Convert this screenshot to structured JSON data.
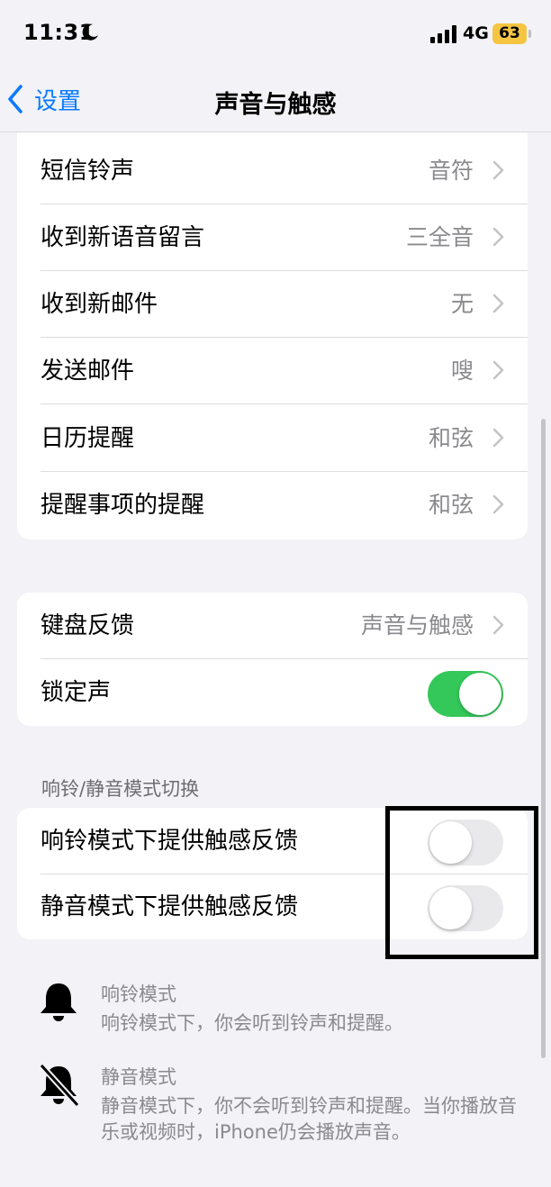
{
  "status": {
    "time": "11:31",
    "network": "4G",
    "battery": "63"
  },
  "nav": {
    "back_label": "设置",
    "title": "声音与触感"
  },
  "alerts": [
    {
      "label": "短信铃声",
      "value": "音符"
    },
    {
      "label": "收到新语音留言",
      "value": "三全音"
    },
    {
      "label": "收到新邮件",
      "value": "无"
    },
    {
      "label": "发送邮件",
      "value": "嗖"
    },
    {
      "label": "日历提醒",
      "value": "和弦"
    },
    {
      "label": "提醒事项的提醒",
      "value": "和弦"
    }
  ],
  "feedback": {
    "keyboard_label": "键盘反馈",
    "keyboard_value": "声音与触感",
    "lock_sound_label": "锁定声",
    "lock_sound_on": true
  },
  "ring_silent": {
    "header": "响铃/静音模式切换",
    "ring_haptics_label": "响铃模式下提供触感反馈",
    "ring_haptics_on": false,
    "silent_haptics_label": "静音模式下提供触感反馈",
    "silent_haptics_on": false
  },
  "info": {
    "ring_title": "响铃模式",
    "ring_desc": "响铃模式下，你会听到铃声和提醒。",
    "silent_title": "静音模式",
    "silent_desc": "静音模式下，你不会听到铃声和提醒。当你播放音乐或视频时，iPhone仍会播放声音。"
  },
  "colors": {
    "accent": "#0a7aff",
    "toggle_on": "#34c759",
    "battery": "#f5c542"
  }
}
